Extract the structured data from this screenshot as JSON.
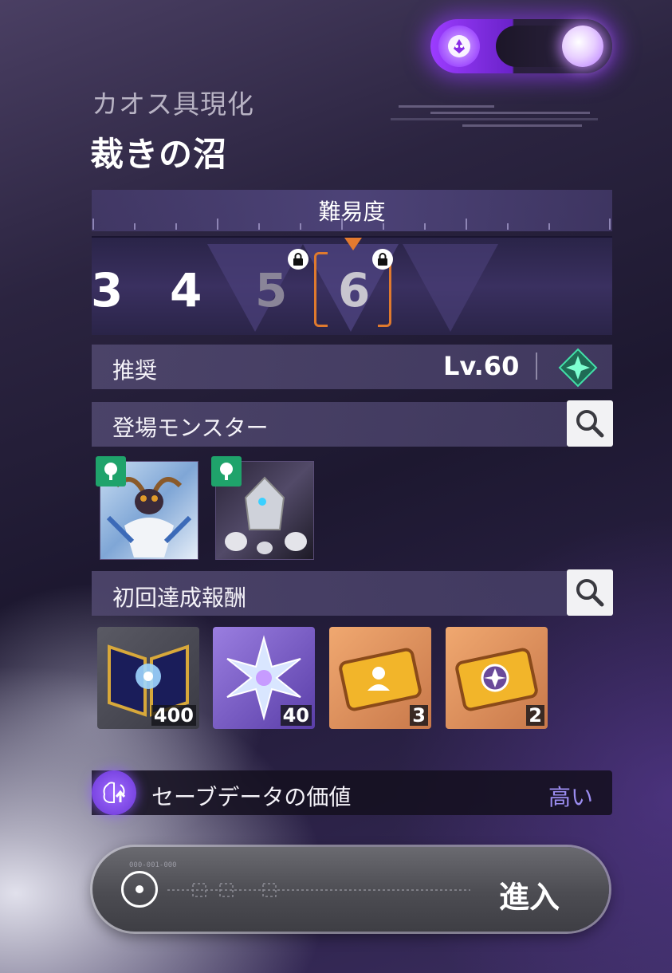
{
  "header": {
    "category": "カオス具現化",
    "stage_name": "裁きの沼"
  },
  "difficulty": {
    "label": "難易度",
    "levels": [
      "3",
      "4",
      "5",
      "6"
    ],
    "selected": "6",
    "locked": [
      "5",
      "6"
    ]
  },
  "recommended": {
    "label": "推奨",
    "level": "Lv.60"
  },
  "monsters": {
    "label": "登場モンスター",
    "icons": [
      "monster-antler-beast",
      "monster-crystal-golem"
    ]
  },
  "rewards": {
    "label": "初回達成報酬",
    "items": [
      {
        "icon": "star-book-icon",
        "qty": "400"
      },
      {
        "icon": "crystal-star-icon",
        "qty": "40"
      },
      {
        "icon": "character-ticket-icon",
        "qty": "3"
      },
      {
        "icon": "gear-ticket-icon",
        "qty": "2"
      }
    ]
  },
  "save_data": {
    "label": "セーブデータの価値",
    "value": "高い",
    "value_color": "#9b8cf0"
  },
  "enter_button": {
    "label": "進入",
    "code": "000-001-000"
  },
  "colors": {
    "accent_purple": "#9c3cff",
    "bracket_orange": "#e07a2e",
    "badge_green": "#1fa36b"
  }
}
